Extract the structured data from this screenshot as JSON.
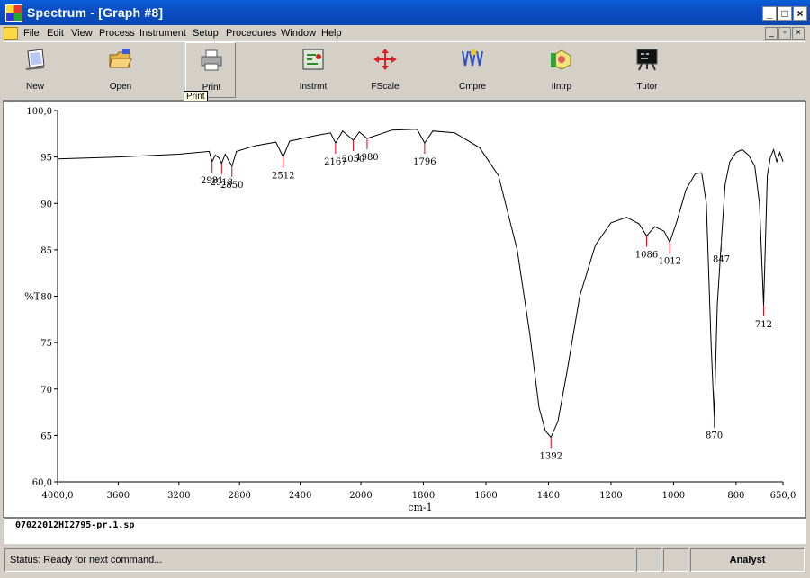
{
  "window": {
    "title": "Spectrum - [Graph #8]",
    "controls": [
      "_",
      "□",
      "×"
    ]
  },
  "menu": {
    "items": [
      "File",
      "Edit",
      "View",
      "Process",
      "Instrument",
      "Setup",
      "Procedures",
      "Window",
      "Help"
    ]
  },
  "toolbar": {
    "buttons": [
      {
        "label": "New",
        "icon": "new-document-icon"
      },
      {
        "label": "Open",
        "icon": "open-folder-icon"
      },
      {
        "label": "Print",
        "icon": "printer-icon"
      },
      {
        "label": "Instrmt",
        "icon": "instrument-icon"
      },
      {
        "label": "FScale",
        "icon": "full-scale-arrows-icon"
      },
      {
        "label": "Cmpre",
        "icon": "compare-icon"
      },
      {
        "label": "iIntrp",
        "icon": "interpret-icon"
      },
      {
        "label": "Tutor",
        "icon": "tutor-board-icon"
      }
    ],
    "tooltip": "Print"
  },
  "chart_data": {
    "type": "line",
    "title": "",
    "xlabel": "cm-1",
    "ylabel": "%T",
    "xlim": [
      4000,
      650
    ],
    "ylim": [
      60,
      100
    ],
    "x_ticks": [
      "4000,0",
      "3600",
      "3200",
      "2800",
      "2400",
      "2000",
      "1800",
      "1600",
      "1400",
      "1200",
      "1000",
      "800",
      "650,0"
    ],
    "y_ticks": [
      "100,0",
      "95",
      "90",
      "85",
      "80",
      "75",
      "70",
      "65",
      "60,0"
    ],
    "spectrum": {
      "x": [
        4000,
        3600,
        3200,
        3000,
        2981,
        2960,
        2935,
        2918,
        2895,
        2850,
        2820,
        2700,
        2560,
        2512,
        2470,
        2300,
        2200,
        2167,
        2120,
        2050,
        2010,
        1980,
        1900,
        1820,
        1796,
        1770,
        1700,
        1620,
        1560,
        1500,
        1460,
        1430,
        1410,
        1392,
        1370,
        1340,
        1300,
        1250,
        1200,
        1150,
        1110,
        1086,
        1060,
        1030,
        1012,
        990,
        960,
        930,
        910,
        895,
        880,
        870,
        860,
        847,
        835,
        820,
        800,
        780,
        760,
        740,
        725,
        712,
        700,
        690,
        680,
        670,
        660,
        650
      ],
      "y": [
        94.8,
        95.0,
        95.3,
        95.6,
        94.5,
        95.2,
        94.9,
        94.3,
        95.3,
        94.0,
        95.6,
        96.2,
        96.6,
        95.0,
        96.7,
        97.3,
        97.6,
        96.5,
        97.8,
        96.8,
        97.7,
        97.0,
        97.9,
        98.0,
        96.5,
        97.8,
        97.6,
        96.0,
        93.0,
        85.0,
        76.0,
        68.0,
        65.5,
        64.8,
        66.5,
        72.0,
        80.0,
        85.5,
        87.9,
        88.5,
        87.8,
        86.5,
        87.5,
        87.0,
        85.8,
        88.0,
        91.5,
        93.2,
        93.3,
        90.0,
        75.0,
        67.0,
        79.0,
        86.0,
        92.0,
        94.5,
        95.5,
        95.8,
        95.2,
        94.0,
        90.0,
        79.0,
        93.0,
        95.0,
        95.8,
        94.5,
        95.5,
        94.5
      ]
    },
    "peaks": [
      {
        "x": 2981,
        "y": 94.5,
        "label": "2981"
      },
      {
        "x": 2918,
        "y": 94.3,
        "label": "2918"
      },
      {
        "x": 2850,
        "y": 94.0,
        "label": "2850"
      },
      {
        "x": 2512,
        "y": 95.0,
        "label": "2512"
      },
      {
        "x": 2167,
        "y": 96.5,
        "label": "2167"
      },
      {
        "x": 2050,
        "y": 96.8,
        "label": "2050"
      },
      {
        "x": 1980,
        "y": 97.0,
        "label": "1980"
      },
      {
        "x": 1796,
        "y": 96.5,
        "label": "1796"
      },
      {
        "x": 1392,
        "y": 64.8,
        "label": "1392"
      },
      {
        "x": 1086,
        "y": 86.5,
        "label": "1086"
      },
      {
        "x": 1012,
        "y": 85.8,
        "label": "1012"
      },
      {
        "x": 870,
        "y": 67.0,
        "label": "870"
      },
      {
        "x": 847,
        "y": 86.0,
        "label": "847"
      },
      {
        "x": 712,
        "y": 79.0,
        "label": "712"
      }
    ],
    "colors": {
      "trace": "#000000",
      "peak_marker": "#e8000b"
    }
  },
  "file": {
    "name": "07022012HI2795-pr.1.sp"
  },
  "status": {
    "text": "Status: Ready for next command...",
    "user": "Analyst"
  }
}
